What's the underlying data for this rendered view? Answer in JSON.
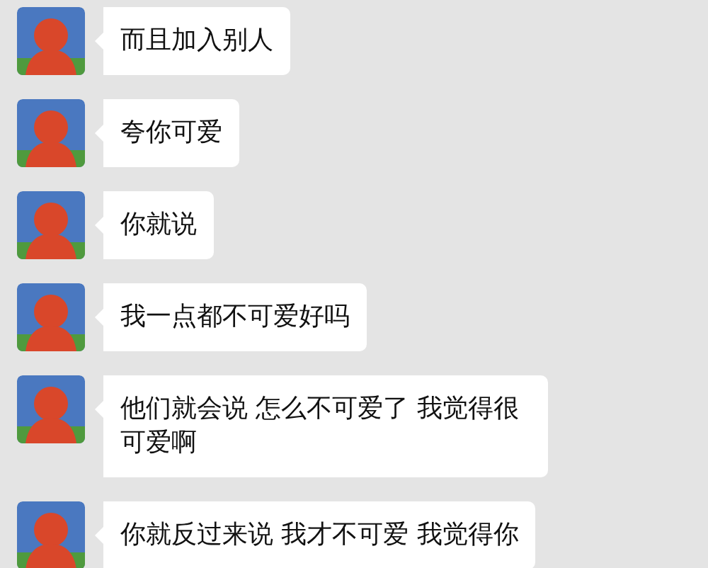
{
  "messages": [
    {
      "text": "而且加入别人"
    },
    {
      "text": "夸你可爱"
    },
    {
      "text": "你就说"
    },
    {
      "text": "我一点都不可爱好吗"
    },
    {
      "text": "他们就会说 怎么不可爱了 我觉得很可爱啊"
    },
    {
      "text": "你就反过来说 我才不可爱 我觉得你"
    }
  ]
}
